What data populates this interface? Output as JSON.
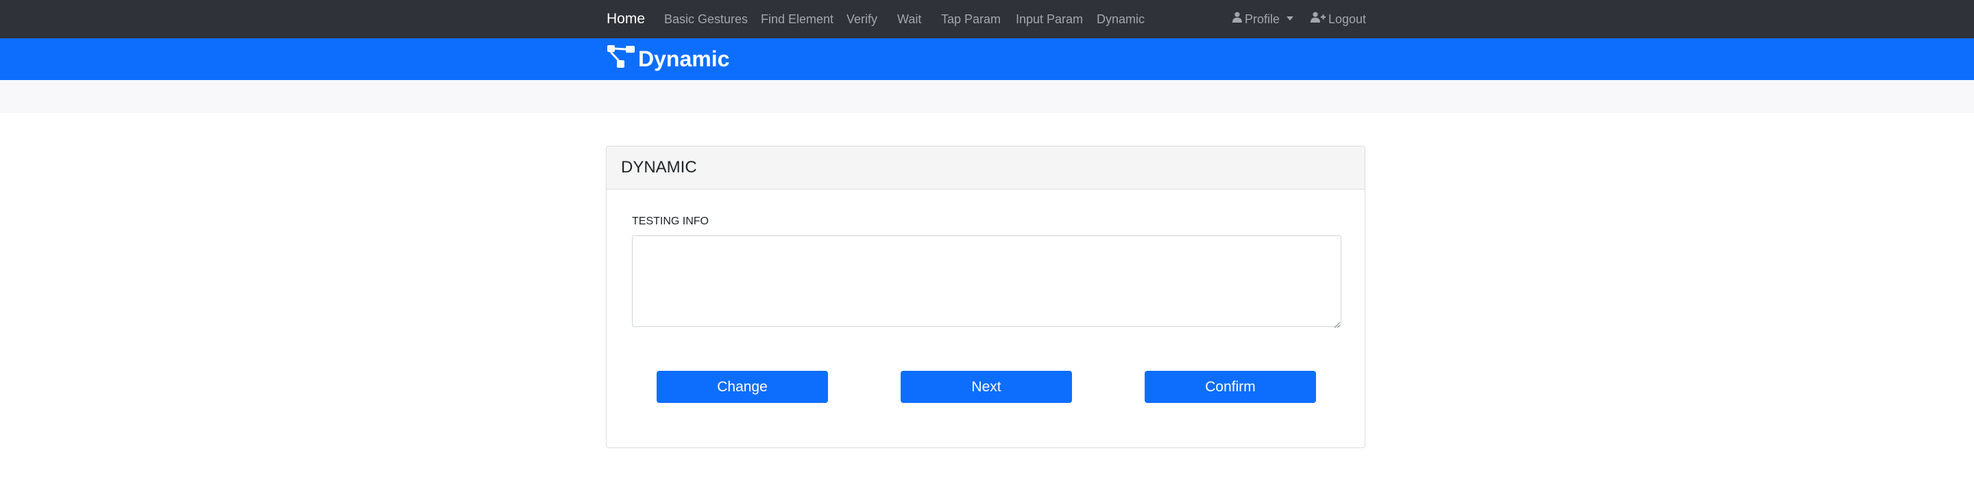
{
  "nav": {
    "home": "Home",
    "links": [
      "Basic Gestures",
      "Find Element",
      "Verify",
      "Wait",
      "Tap Param",
      "Input Param",
      "Dynamic"
    ],
    "profile_label": "Profile",
    "logout_label": "Logout",
    "icons": {
      "profile": "user-icon",
      "logout": "user-plus-icon"
    }
  },
  "brand": {
    "title": "Dynamic",
    "logo_icon": "diagram-nodes-icon"
  },
  "card": {
    "title": "DYNAMIC",
    "field_label": "TESTING INFO",
    "field_value": "",
    "buttons": {
      "change": "Change",
      "next": "Next",
      "confirm": "Confirm"
    }
  },
  "colors": {
    "navbar_bg": "#2f3238",
    "brand_bg": "#0d6efd",
    "button_bg": "#0d6efd",
    "nav_text": "#a3a7ad"
  }
}
